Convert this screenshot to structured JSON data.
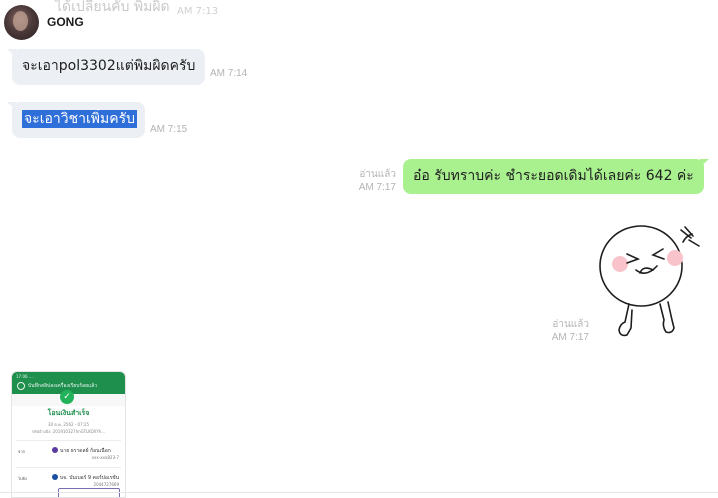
{
  "chat": {
    "faded_top_text": "ได้เปลี่ยนคับ พิมผิด",
    "faded_top_time": "AM 7:13",
    "sender_name": "GONG",
    "messages": [
      {
        "text": "จะเอาpol3302แต่พิมผิดครับ",
        "time": "AM 7:14"
      },
      {
        "text": "จะเอาวิชาเพิ่มครับ",
        "time": "AM 7:15"
      },
      {
        "text": "อ๋อ รับทราบค่ะ ชำระยอดเดิมได้เลยค่ะ 642 ค่ะ",
        "read": "อ่านแล้ว",
        "time": "AM 7:17"
      },
      {
        "sticker": "laughing-character-sticker",
        "read": "อ่านแล้ว",
        "time": "AM 7:17"
      }
    ]
  },
  "receipt": {
    "header_status_bar": "17:06  ....  ",
    "header_title": "บันทึกสลิปลงเครื่องเรียบร้อยแล้ว",
    "status": "โอนเงินสำเร็จ",
    "date": "30 ต.ค. 2562 - 07:25",
    "ref": "รหัสอ้างอิง: 201910327hnGTLKOXYh...",
    "from_label": "จาก",
    "from_name": "นาย ธราดลย์ ก้อนเนือก",
    "from_account": "xxx-xxx823-7",
    "to_label": "ไปยัง",
    "to_name": "บจ. บัมเบอร์ 9 คอร์ปอเรชั่น",
    "to_account": "2044727669"
  },
  "colors": {
    "outgoing_bubble": "#a9f08f",
    "incoming_bubble": "#eceff3",
    "selection": "#2f6fd9",
    "receipt_green": "#1f8f4e"
  }
}
